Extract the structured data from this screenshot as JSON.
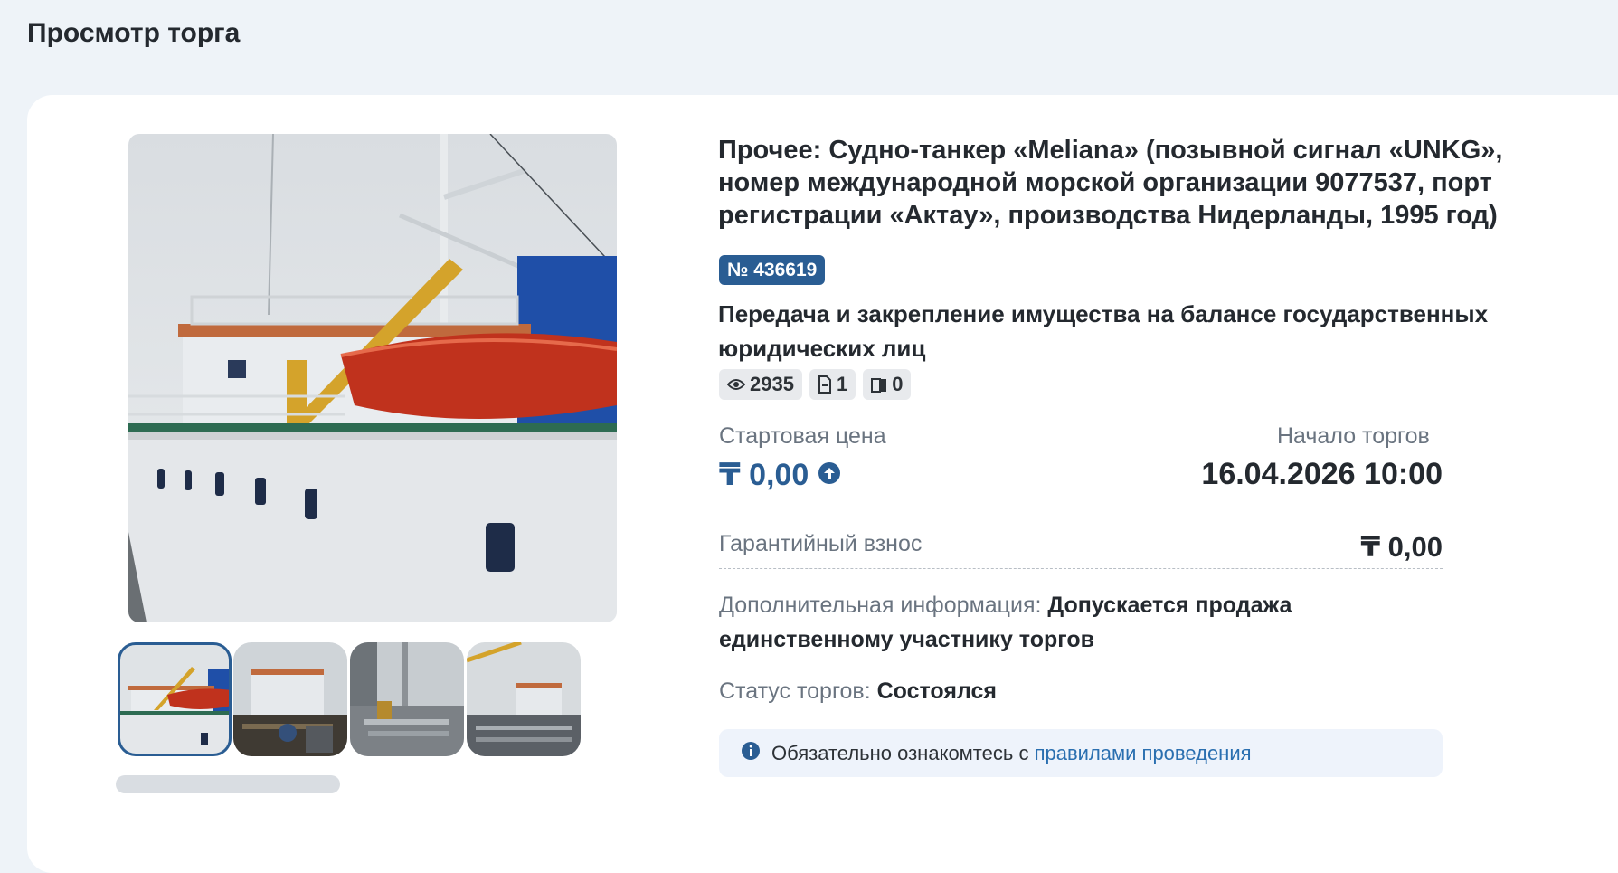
{
  "page": {
    "title": "Просмотр торга"
  },
  "lot": {
    "title": "Прочее: Судно-танкер «Meliana» (позывной сигнал «UNKG», номер международной морской организации 9077537, порт регистрации «Актау», производства Нидерланды, 1995 год)",
    "number": "№ 436619",
    "type": "Передача и закрепление имущества на балансе государственных юридических лиц"
  },
  "stats": {
    "views": "2935",
    "documents": "1",
    "bids": "0"
  },
  "price": {
    "start_label": "Стартовая цена",
    "start_value": "₸ 0,00",
    "start_time_label": "Начало торгов",
    "start_time_value": "16.04.2026 10:00",
    "deposit_label": "Гарантийный взнос",
    "deposit_value": "₸ 0,00"
  },
  "extra": {
    "label": "Дополнительная информация:",
    "value": "Допускается продажа единственному участнику торгов"
  },
  "status": {
    "label": "Статус торгов:",
    "value": "Состоялся"
  },
  "notice": {
    "text": "Обязательно ознакомтесь с",
    "link": "правилами проведения"
  },
  "icons": {
    "views": "eye-icon",
    "documents": "document-icon",
    "bids": "bid-icon",
    "price_direction": "arrow-up-circle-icon",
    "notice": "info-icon"
  },
  "colors": {
    "accent": "#2a5d93",
    "link": "#2a6fb0",
    "background": "#eef3f8"
  },
  "gallery": {
    "thumbnail_count": 4,
    "active_thumbnail": 0
  }
}
